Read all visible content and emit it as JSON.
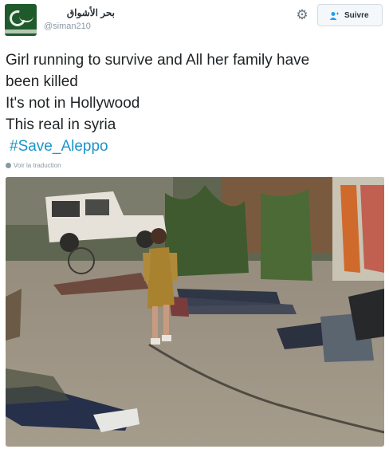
{
  "tweet": {
    "display_name": "بحر الأشواق",
    "handle": "@siman210",
    "lines": [
      "Girl running to survive and All her family have",
      "been killed",
      "It's not in Hollywood",
      "This real in syria"
    ],
    "hashtag": "#Save_Aleppo",
    "translate_label": "Voir la traduction"
  },
  "header": {
    "follow_label": "Suivre",
    "settings_icon": "gear-icon",
    "follow_icon": "add-user-icon"
  },
  "colors": {
    "hashtag": "#1b95c9",
    "avatar": "#1f5a2c",
    "muted": "#8899a6"
  }
}
